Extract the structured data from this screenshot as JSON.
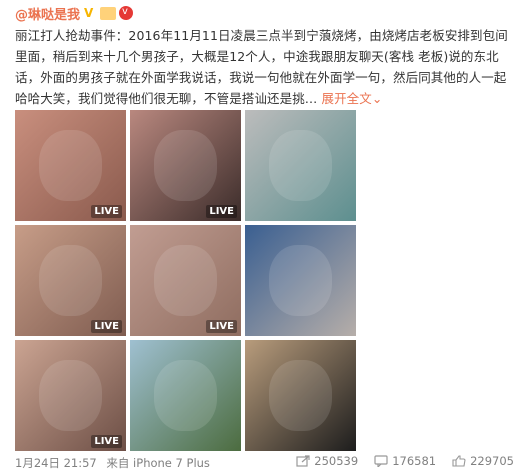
{
  "post": {
    "username": "@琳哒是我",
    "text_main": "丽江打人抢劫事件：2016年11月11日凌晨三点半到宁蒗烧烤，由烧烤店老板安排到包间里面，稍后到来十几个男孩子，大概是12个人，中途我跟朋友聊天(客栈 老板)说的东北话，外面的男孩子就在外面学我说话，我说一句他就在外面学一句，然后同其他的人一起哈哈大笑，我们觉得他们很无聊，不管是搭讪还是挑…",
    "expand_label": "展开全文",
    "expand_arrow": "⌄"
  },
  "images": [
    {
      "live": "LIVE",
      "colors": [
        "#c98f7e",
        "#8a5a4d"
      ]
    },
    {
      "live": "LIVE",
      "colors": [
        "#b9887f",
        "#3b2c2a"
      ]
    },
    {
      "live": "",
      "colors": [
        "#bcbcbc",
        "#5d8f8f"
      ]
    },
    {
      "live": "LIVE",
      "colors": [
        "#c79d88",
        "#7f5c50"
      ]
    },
    {
      "live": "LIVE",
      "colors": [
        "#c19d92",
        "#8f6d60"
      ]
    },
    {
      "live": "",
      "colors": [
        "#3a5f91",
        "#b6aea9"
      ]
    },
    {
      "live": "LIVE",
      "colors": [
        "#cba492",
        "#6d4f46"
      ]
    },
    {
      "live": "",
      "colors": [
        "#9fc0d1",
        "#4c6c3f"
      ]
    },
    {
      "live": "",
      "colors": [
        "#b89c7c",
        "#1d1d1d"
      ]
    }
  ],
  "footer": {
    "timestamp": "1月24日 21:57",
    "source": "来自 iPhone 7 Plus",
    "shares": "250539",
    "comments": "176581",
    "likes": "229705"
  },
  "colors": {
    "accent": "#eb7350",
    "muted": "#808080"
  }
}
